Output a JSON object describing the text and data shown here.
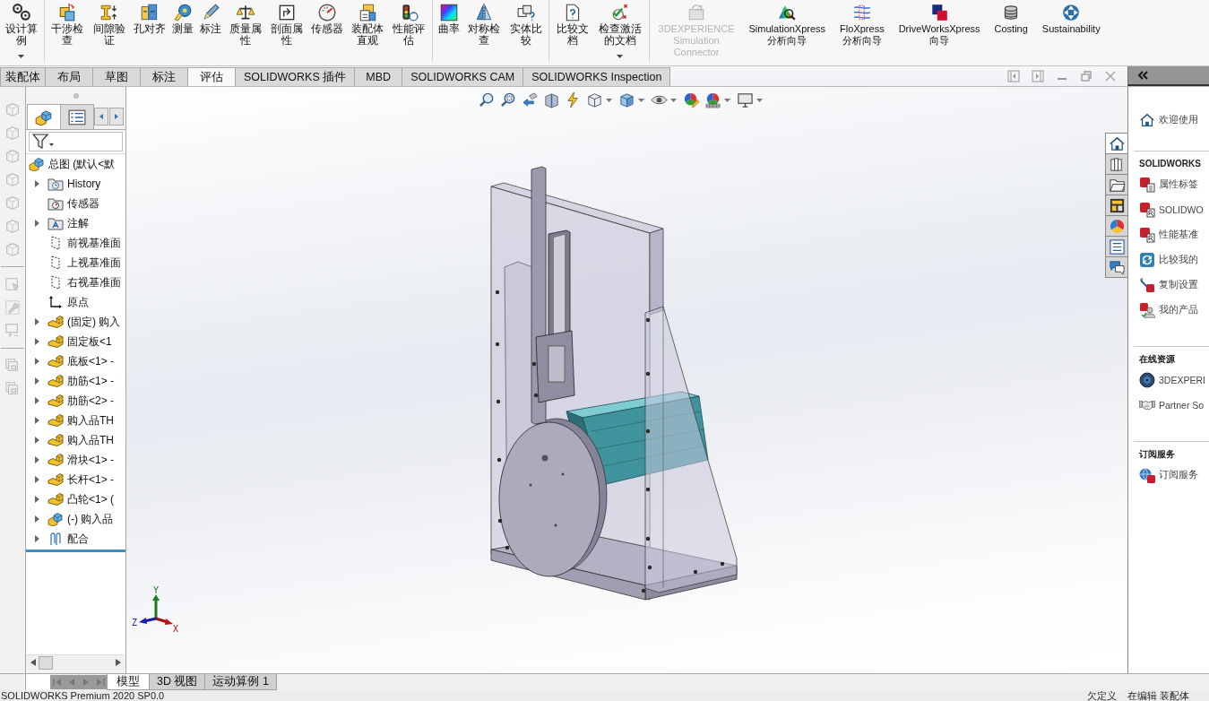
{
  "command_manager": {
    "groups": [
      {
        "items": [
          {
            "label": "设计算例",
            "has_menu": true,
            "disabled": false
          }
        ]
      },
      {
        "items": [
          {
            "label": "干涉检查",
            "has_menu": false,
            "disabled": false
          },
          {
            "label": "间隙验证",
            "has_menu": false,
            "disabled": false
          },
          {
            "label": "孔对齐",
            "has_menu": false,
            "disabled": false
          },
          {
            "label": "测量",
            "has_menu": false,
            "disabled": false
          },
          {
            "label": "标注",
            "has_menu": false,
            "disabled": false
          },
          {
            "label": "质量属性",
            "has_menu": false,
            "disabled": false
          },
          {
            "label": "剖面属性",
            "has_menu": false,
            "disabled": false
          },
          {
            "label": "传感器",
            "has_menu": false,
            "disabled": false
          },
          {
            "label": "装配体直观",
            "has_menu": false,
            "disabled": false
          },
          {
            "label": "性能评估",
            "has_menu": false,
            "disabled": false
          }
        ]
      },
      {
        "items": [
          {
            "label": "曲率",
            "has_menu": false,
            "disabled": false
          },
          {
            "label": "对称检查",
            "has_menu": false,
            "disabled": false
          },
          {
            "label": "实体比较",
            "has_menu": false,
            "disabled": false
          }
        ]
      },
      {
        "items": [
          {
            "label": "比较文档",
            "has_menu": false,
            "disabled": false
          },
          {
            "label": "检查激活的文档",
            "has_menu": true,
            "disabled": false
          }
        ]
      },
      {
        "items": [
          {
            "label": "3DEXPERIENCE Simulation Connector",
            "has_menu": false,
            "disabled": true
          },
          {
            "label": "SimulationXpress 分析向导",
            "has_menu": false,
            "disabled": false
          },
          {
            "label": "FloXpress 分析向导",
            "has_menu": false,
            "disabled": false
          },
          {
            "label": "DriveWorksXpress 向导",
            "has_menu": false,
            "disabled": false
          },
          {
            "label": "Costing",
            "has_menu": false,
            "disabled": false
          },
          {
            "label": "Sustainability",
            "has_menu": false,
            "disabled": false
          }
        ]
      }
    ]
  },
  "command_tabs": [
    {
      "label": "装配体",
      "selected": false
    },
    {
      "label": "布局",
      "selected": false
    },
    {
      "label": "草图",
      "selected": false
    },
    {
      "label": "标注",
      "selected": false
    },
    {
      "label": "评估",
      "selected": true
    },
    {
      "label": "SOLIDWORKS 插件",
      "selected": false
    },
    {
      "label": "MBD",
      "selected": false
    },
    {
      "label": "SOLIDWORKS CAM",
      "selected": false
    },
    {
      "label": "SOLIDWORKS Inspection",
      "selected": false
    }
  ],
  "feature_manager": {
    "tabs": [
      {
        "selected": true
      },
      {
        "selected": false
      }
    ],
    "root": {
      "label": "总图 (默认<默"
    },
    "items": [
      {
        "label": "History",
        "kind": "history",
        "expandable": true
      },
      {
        "label": "传感器",
        "kind": "sensors",
        "expandable": false
      },
      {
        "label": "注解",
        "kind": "annotations",
        "expandable": true
      },
      {
        "label": "前视基准面",
        "kind": "plane",
        "expandable": false
      },
      {
        "label": "上视基准面",
        "kind": "plane",
        "expandable": false
      },
      {
        "label": "右视基准面",
        "kind": "plane",
        "expandable": false
      },
      {
        "label": "原点",
        "kind": "origin",
        "expandable": false
      },
      {
        "label": "(固定) 购入",
        "kind": "part",
        "expandable": true
      },
      {
        "label": "固定板<1",
        "kind": "part",
        "expandable": true
      },
      {
        "label": "底板<1> -",
        "kind": "part",
        "expandable": true
      },
      {
        "label": "肋筋<1> -",
        "kind": "part",
        "expandable": true
      },
      {
        "label": "肋筋<2> -",
        "kind": "part",
        "expandable": true
      },
      {
        "label": "购入品TH",
        "kind": "part",
        "expandable": true
      },
      {
        "label": "购入品TH",
        "kind": "part",
        "expandable": true
      },
      {
        "label": "滑块<1> -",
        "kind": "part",
        "expandable": true
      },
      {
        "label": "长杆<1> -",
        "kind": "part",
        "expandable": true
      },
      {
        "label": "凸轮<1> (",
        "kind": "part",
        "expandable": true
      },
      {
        "label": "(-) 购入品",
        "kind": "subassembly",
        "expandable": true
      },
      {
        "label": "配合",
        "kind": "mates",
        "expandable": true
      }
    ]
  },
  "viewport": {
    "triad": {
      "x": "X",
      "y": "Y",
      "z": "Z"
    },
    "task_tabs": [
      {
        "selected": true
      },
      {
        "selected": false
      },
      {
        "selected": false
      },
      {
        "selected": false
      },
      {
        "selected": false
      },
      {
        "selected": false
      },
      {
        "selected": false
      }
    ]
  },
  "task_pane": {
    "welcome": "欢迎使用",
    "sections": [
      {
        "title": "SOLIDWORKS",
        "items": [
          {
            "label": "属性标签",
            "kind": "tag"
          },
          {
            "label": "SOLIDWO",
            "kind": "rx"
          },
          {
            "label": "性能基准",
            "kind": "benchmark"
          },
          {
            "label": "比较我的",
            "kind": "compare"
          },
          {
            "label": "复制设置",
            "kind": "copy"
          },
          {
            "label": "我的产品",
            "kind": "products"
          }
        ]
      },
      {
        "title": "在线资源",
        "items": [
          {
            "label": "3DEXPERI",
            "kind": "platform"
          },
          {
            "label": "Partner So",
            "kind": "partner"
          }
        ]
      },
      {
        "title": "订阅服务",
        "items": [
          {
            "label": "订阅服务",
            "kind": "subscription"
          }
        ]
      }
    ]
  },
  "bottom_tabs": [
    {
      "label": "模型",
      "selected": true
    },
    {
      "label": "3D 视图",
      "selected": false
    },
    {
      "label": "运动算例 1",
      "selected": false
    }
  ],
  "status_bar": {
    "product": "SOLIDWORKS Premium 2020 SP0.0",
    "definition": "欠定义",
    "mode": "在编辑 装配体"
  }
}
